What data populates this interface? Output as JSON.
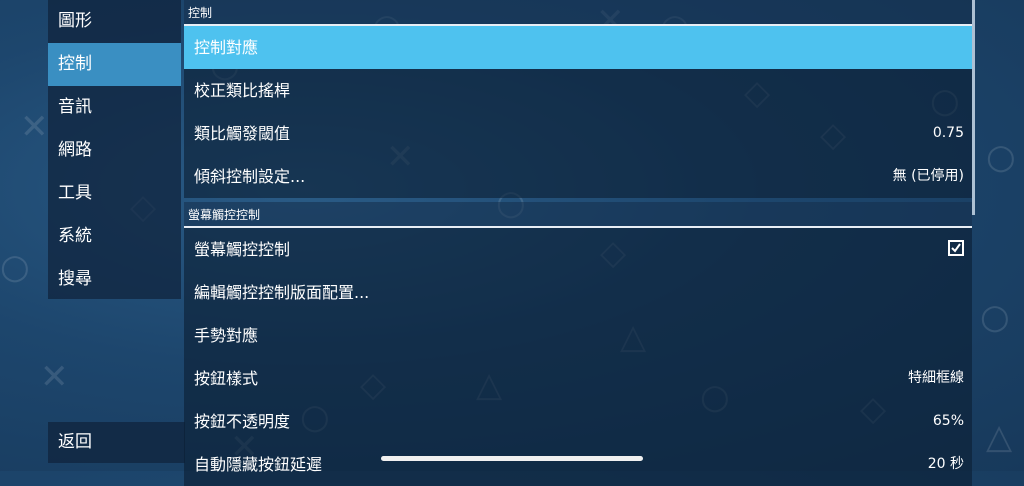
{
  "sidebar": {
    "items": [
      {
        "label": "圖形"
      },
      {
        "label": "控制",
        "selected": true
      },
      {
        "label": "音訊"
      },
      {
        "label": "網路"
      },
      {
        "label": "工具"
      },
      {
        "label": "系統"
      },
      {
        "label": "搜尋"
      }
    ],
    "back_label": "返回"
  },
  "sections": {
    "controls_header": "控制",
    "touch_header": "螢幕觸控控制"
  },
  "rows": {
    "control_mapping": {
      "label": "控制對應"
    },
    "calibrate_stick": {
      "label": "校正類比搖桿"
    },
    "analog_trigger": {
      "label": "類比觸發閾值",
      "value": "0.75"
    },
    "tilt_settings": {
      "label": "傾斜控制設定...",
      "value": "無 (已停用)"
    },
    "touch_controls": {
      "label": "螢幕觸控控制",
      "checked": true
    },
    "edit_layout": {
      "label": "編輯觸控控制版面配置..."
    },
    "gesture_mapping": {
      "label": "手勢對應"
    },
    "button_style": {
      "label": "按鈕樣式",
      "value": "特細框線"
    },
    "button_opacity": {
      "label": "按鈕不透明度",
      "value": "65%"
    },
    "auto_hide_delay": {
      "label": "自動隱藏按鈕延遲",
      "value": "20 秒"
    }
  },
  "colors": {
    "selected_row": "#4ec2ef",
    "selected_sidebar": "#3a8fc2",
    "background": "#1d466d"
  }
}
